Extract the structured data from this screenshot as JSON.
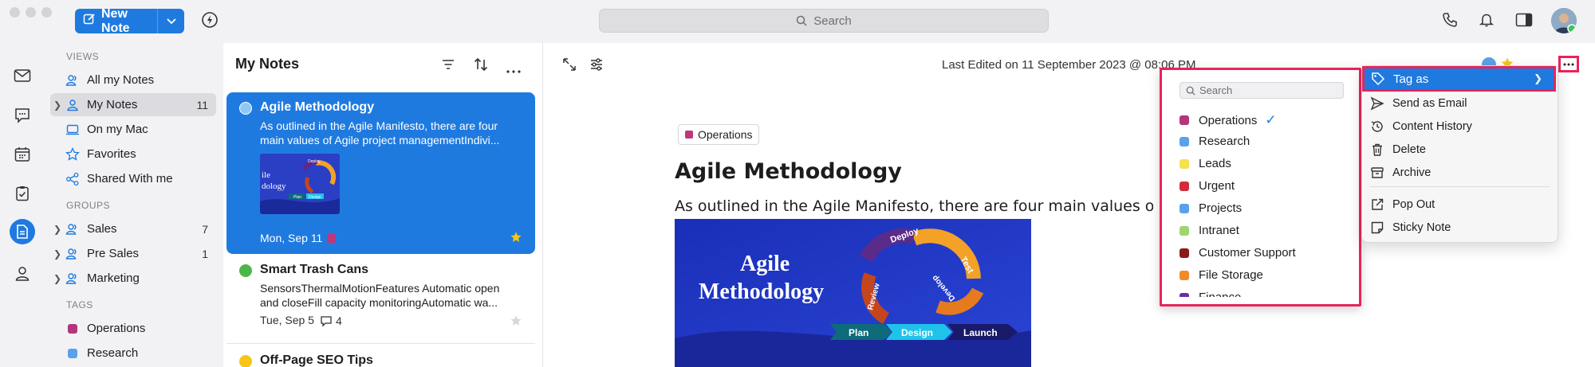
{
  "toolbar": {
    "new_note_label": "New Note",
    "search_placeholder": "Search"
  },
  "sidebar": {
    "views_header": "VIEWS",
    "views": [
      {
        "label": "All my Notes"
      },
      {
        "label": "My Notes",
        "count": "11"
      },
      {
        "label": "On my Mac"
      },
      {
        "label": "Favorites"
      },
      {
        "label": "Shared With me"
      }
    ],
    "groups_header": "GROUPS",
    "groups": [
      {
        "label": "Sales",
        "count": "7"
      },
      {
        "label": "Pre Sales",
        "count": "1"
      },
      {
        "label": "Marketing",
        "count": ""
      }
    ],
    "tags_header": "TAGS",
    "tags": [
      {
        "label": "Operations",
        "color": "#b5357a"
      },
      {
        "label": "Research",
        "color": "#5aa2e8"
      }
    ]
  },
  "notes": {
    "title": "My Notes",
    "items": [
      {
        "title": "Agile Methodology",
        "body": "As outlined in the Agile Manifesto, there are four main values of Agile project managementIndivi...",
        "date": "Mon, Sep 11",
        "status_color": "#8ec9f5",
        "tag_color": "#c0367a"
      },
      {
        "title": "Smart Trash Cans",
        "body_line1": "SensorsThermalMotionFeatures Automatic open",
        "body_line2": "and closeFill capacity monitoringAutomatic wa...",
        "date": "Tue, Sep 5",
        "comments": "4",
        "status_color": "#4cb748"
      },
      {
        "title": "Off-Page SEO Tips",
        "status_color": "#f5c518"
      }
    ],
    "thumb": {
      "line1": "ile",
      "line2": "dology",
      "deploy": "Deploy",
      "plan": "Plan",
      "design": "Design"
    }
  },
  "editor": {
    "last_edited": "Last Edited on 11 September 2023 @ 08:06 PM",
    "tag_chip": "Operations",
    "tag_chip_color": "#c0367a",
    "heading": "Agile Methodology",
    "paragraph": "As outlined in the Agile Manifesto, there are four main values of Agile project management",
    "image": {
      "title_line1": "Agile",
      "title_line2": "Methodology",
      "deploy": "Deploy",
      "test": "Test",
      "review": "Review",
      "develop": "Develop",
      "plan": "Plan",
      "design": "Design",
      "launch": "Launch"
    }
  },
  "tag_dropdown": {
    "search_placeholder": "Search",
    "items": [
      {
        "label": "Operations",
        "color": "#b5357a",
        "checked": true,
        "check": "✓"
      },
      {
        "label": "Research",
        "color": "#5aa2e8"
      },
      {
        "label": "Leads",
        "color": "#f4e24e"
      },
      {
        "label": "Urgent",
        "color": "#d12b3a"
      },
      {
        "label": "Projects",
        "color": "#5aa2e8"
      },
      {
        "label": "Intranet",
        "color": "#9fd56e"
      },
      {
        "label": "Customer Support",
        "color": "#8b1a1a"
      },
      {
        "label": "File Storage",
        "color": "#f08a2c"
      },
      {
        "label": "Finance",
        "color": "#6a2ea0"
      }
    ]
  },
  "context_menu": {
    "items": [
      "Tag as",
      "Send as Email",
      "Content History",
      "Delete",
      "Archive",
      "Pop Out",
      "Sticky Note"
    ]
  },
  "colors": {
    "accent": "#1f7ae0",
    "highlight": "#e8245a"
  }
}
